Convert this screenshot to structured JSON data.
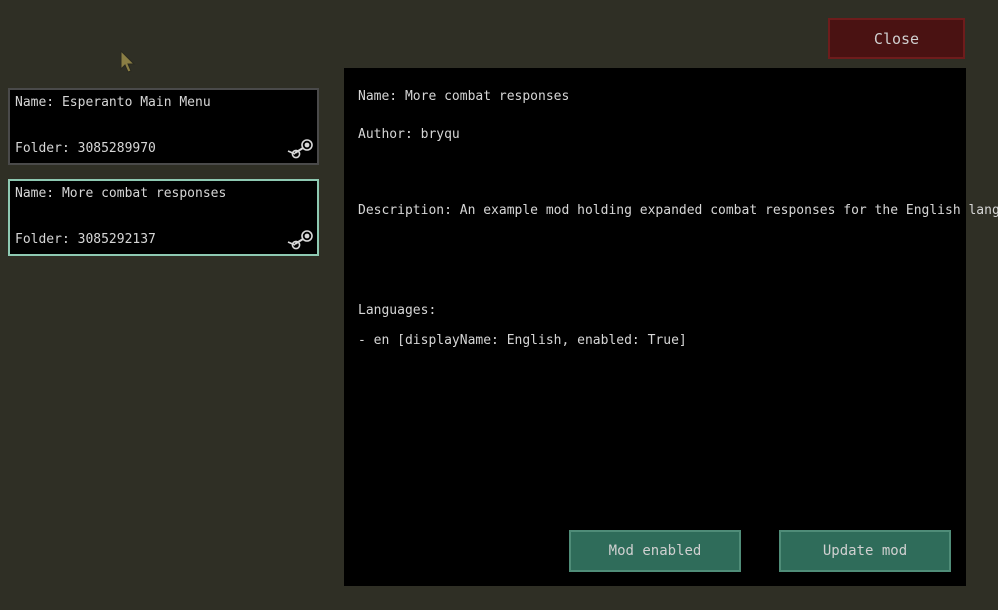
{
  "window": {
    "close_label": "Close"
  },
  "mods": [
    {
      "name": "Name: Esperanto Main Menu",
      "folder": "Folder: 3085289970",
      "source_icon": "steam-icon",
      "selected": false
    },
    {
      "name": "Name: More combat responses",
      "folder": "Folder: 3085292137",
      "source_icon": "steam-icon",
      "selected": true
    }
  ],
  "detail": {
    "name": "Name: More combat responses",
    "author": "Author: bryqu",
    "description": "Description: An example mod holding expanded combat responses for the English language.",
    "languages_header": "Languages:",
    "languages": [
      "- en [displayName: English, enabled: True]"
    ]
  },
  "actions": {
    "mod_enabled_label": "Mod enabled",
    "update_mod_label": "Update mod"
  },
  "colors": {
    "background": "#2f2f25",
    "panel": "#000000",
    "close_button": "#4a1212",
    "action_button": "#2f6c5a",
    "selected_border": "#8ec9b2"
  }
}
